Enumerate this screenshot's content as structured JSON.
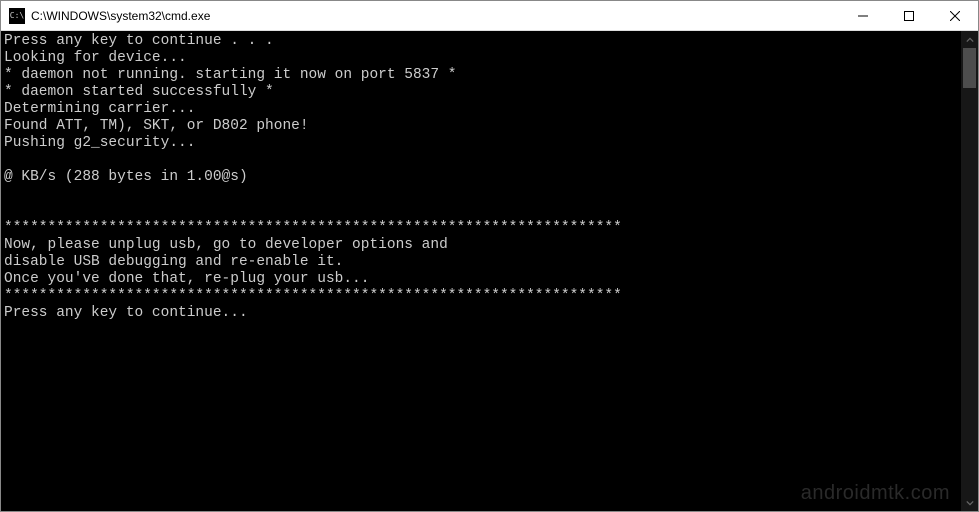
{
  "titlebar": {
    "icon_symbol": "C:\\",
    "title": "C:\\WINDOWS\\system32\\cmd.exe"
  },
  "terminal": {
    "lines": [
      "Press any key to continue . . .",
      "Looking for device...",
      "* daemon not running. starting it now on port 5837 *",
      "* daemon started successfully *",
      "Determining carrier...",
      "Found ATT, TM), SKT, or D802 phone!",
      "Pushing g2_security...",
      "",
      "@ KB/s (288 bytes in 1.00@s)",
      "",
      "",
      "***********************************************************************",
      "Now, please unplug usb, go to developer options and",
      "disable USB debugging and re-enable it.",
      "Once you've done that, re-plug your usb...",
      "***********************************************************************",
      "Press any key to continue..."
    ]
  },
  "watermark": "androidmtk.com"
}
